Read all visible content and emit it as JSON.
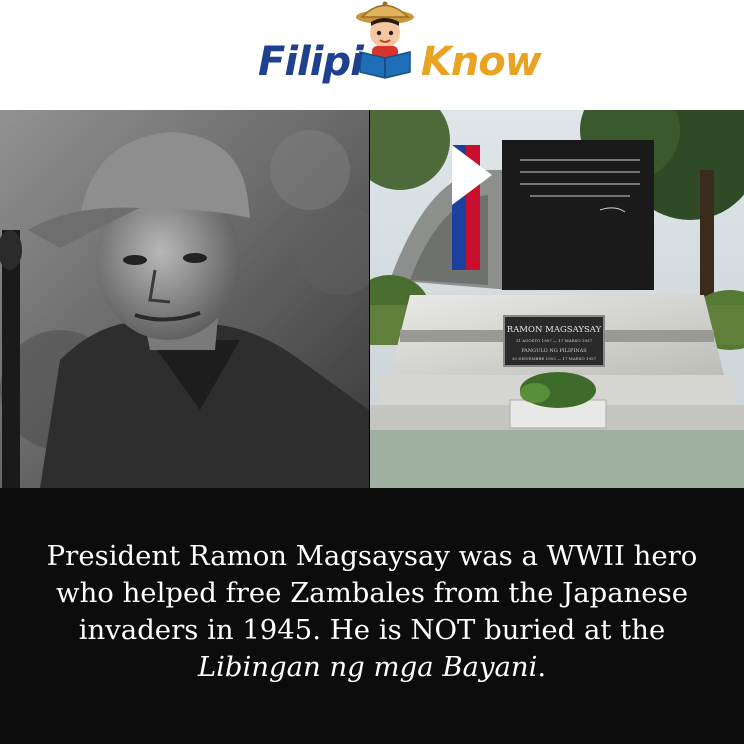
{
  "logo": {
    "text_part1": "Filipi",
    "text_part2": "Know",
    "colors": {
      "blue": "#1f3f8f",
      "gold": "#e7a321"
    },
    "mascot_icon": "reading-kid-with-salakot-icon"
  },
  "photos": {
    "left": {
      "description_icon": "soldier-portrait-photo"
    },
    "right": {
      "description_icon": "tomb-memorial-photo",
      "plaque_name": "RAMON MAGSAYSAY",
      "plaque_line1": "31 AGOSTO 1907 — 17 MARSO 1957",
      "plaque_line2": "PANGULO NG PILIPINAS",
      "plaque_line3": "30 DISYEMBRE 1953 — 17 MARSO 1957"
    }
  },
  "caption": {
    "line1": "President Ramon Magsaysay was a WWII hero",
    "line2": "who helped free Zambales from the Japanese",
    "line3": "invaders in 1945. He is NOT buried at the",
    "line4_italic": "Libingan ng mga Bayani",
    "line4_end": "."
  }
}
